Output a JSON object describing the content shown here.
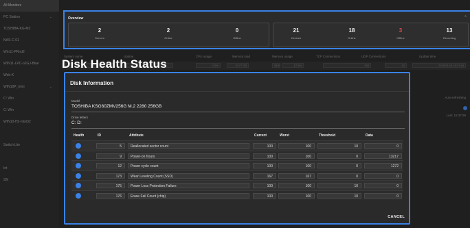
{
  "sidebar": {
    "items": [
      {
        "label": "All Monitors",
        "active": true
      },
      {
        "label": "PC Station",
        "caret": "⌄"
      },
      {
        "label": "TOSHIBA-KG-M2"
      },
      {
        "label": "NAS-C-01"
      },
      {
        "label": "Win11-PRnd2"
      },
      {
        "label": "WIN11-LPC-o2GJ-Blue"
      },
      {
        "label": "Web-K"
      },
      {
        "label": "WIN10P_mini",
        "caret": "⌄"
      },
      {
        "label": "C: Win"
      },
      {
        "label": "C: Win"
      },
      {
        "label": "WIN10-H2-mini32"
      },
      {
        "label": ""
      },
      {
        "label": "Switch Lite"
      },
      {
        "label": ""
      },
      {
        "label": "Int"
      },
      {
        "label": "SN"
      }
    ]
  },
  "overview": {
    "title": "Overview",
    "servers": [
      {
        "value": "2",
        "label": "Servers"
      },
      {
        "value": "2",
        "label": "Online"
      },
      {
        "value": "0",
        "label": "Offline"
      }
    ],
    "devices": [
      {
        "value": "21",
        "label": "Devices",
        "red": false
      },
      {
        "value": "18",
        "label": "Online",
        "red": false
      },
      {
        "value": "3",
        "label": "Offline",
        "red": true
      },
      {
        "value": "13",
        "label": "Recording",
        "red": false
      }
    ]
  },
  "background_table": {
    "headers": [
      "System name",
      "Uptime",
      "CPU usage",
      "Memory load",
      "Memory usage",
      "TCP Connections",
      "UDP Connections",
      "Update time"
    ],
    "row": [
      "",
      "",
      "1.5%",
      "15.77 GB",
      "5820",
      "12.5%",
      "298",
      "10",
      "2025/01/16 15:37:49"
    ]
  },
  "page_title": "Disk Health Status",
  "right_panel": {
    "label": "Auto-refreshing",
    "time": "Last: 15:37:59"
  },
  "dialog": {
    "title": "Disk Information",
    "model_label": "Model",
    "model_value": "TOSHIBA KSG60ZMV256G M.2 2280 256GB",
    "drive_label": "Drive letters",
    "drive_value": "C: D:",
    "columns": {
      "health": "Health",
      "id": "ID",
      "attribute": "Attribute",
      "current": "Current",
      "worst": "Worst",
      "threshold": "Threshold",
      "data": "Data"
    },
    "rows": [
      {
        "id": "5",
        "attribute": "Reallocated sector count",
        "current": "100",
        "worst": "100",
        "threshold": "10",
        "data": "0"
      },
      {
        "id": "9",
        "attribute": "Power-on hours",
        "current": "100",
        "worst": "100",
        "threshold": "0",
        "data": "13217"
      },
      {
        "id": "12",
        "attribute": "Power cycle count",
        "current": "100",
        "worst": "100",
        "threshold": "0",
        "data": "1272"
      },
      {
        "id": "173",
        "attribute": "Wear Leveling Count (SSD)",
        "current": "167",
        "worst": "167",
        "threshold": "0",
        "data": "0"
      },
      {
        "id": "175",
        "attribute": "Power Loss Protection Failure",
        "current": "100",
        "worst": "100",
        "threshold": "10",
        "data": "0"
      },
      {
        "id": "176",
        "attribute": "Erase Fail Count (chip)",
        "current": "100",
        "worst": "100",
        "threshold": "10",
        "data": "0"
      }
    ],
    "cancel_label": "CANCEL"
  },
  "colors": {
    "accent": "#3b82e8",
    "offline_red": "#e14b4b",
    "background": "#1f1f1f"
  }
}
